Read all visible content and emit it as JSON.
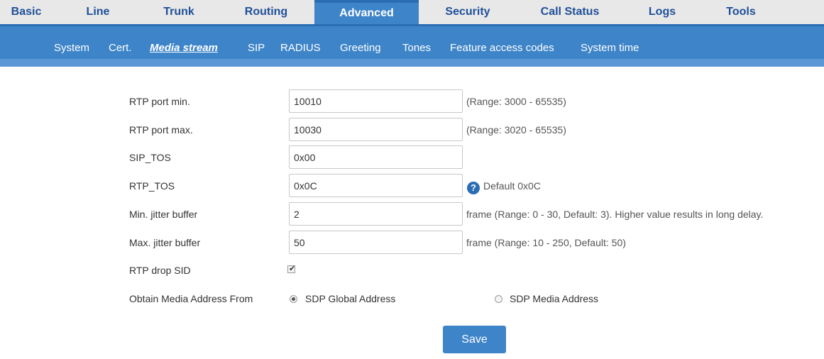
{
  "top_tabs": [
    {
      "label": "Basic"
    },
    {
      "label": "Line"
    },
    {
      "label": "Trunk"
    },
    {
      "label": "Routing"
    },
    {
      "label": "Advanced"
    },
    {
      "label": "Security"
    },
    {
      "label": "Call Status"
    },
    {
      "label": "Logs"
    },
    {
      "label": "Tools"
    }
  ],
  "active_top_tab": "Advanced",
  "sub_tabs": [
    {
      "label": "System"
    },
    {
      "label": "Cert."
    },
    {
      "label": "Media stream"
    },
    {
      "label": "SIP"
    },
    {
      "label": "RADIUS"
    },
    {
      "label": "Greeting"
    },
    {
      "label": "Tones"
    },
    {
      "label": "Feature access codes"
    },
    {
      "label": "System time"
    }
  ],
  "active_sub_tab": "Media stream",
  "form": {
    "rtp_port_min": {
      "label": "RTP port min.",
      "value": "10010",
      "hint": "(Range: 3000 - 65535)"
    },
    "rtp_port_max": {
      "label": "RTP port max.",
      "value": "10030",
      "hint": "(Range: 3020 - 65535)"
    },
    "sip_tos": {
      "label": "SIP_TOS",
      "value": "0x00"
    },
    "rtp_tos": {
      "label": "RTP_TOS",
      "value": "0x0C",
      "hint": "Default 0x0C",
      "help_icon": "question-circle-icon"
    },
    "min_jitter": {
      "label": "Min. jitter buffer",
      "value": "2",
      "hint": "frame (Range: 0 - 30, Default: 3). Higher value results in long delay."
    },
    "max_jitter": {
      "label": "Max. jitter buffer",
      "value": "50",
      "hint": "frame (Range: 10 - 250, Default: 50)"
    },
    "rtp_drop_sid": {
      "label": "RTP drop SID",
      "checked": true
    },
    "media_address": {
      "label": "Obtain Media Address From",
      "options": [
        "SDP Global Address",
        "SDP Media Address"
      ],
      "selected": "SDP Global Address"
    }
  },
  "save_label": "Save",
  "colors": {
    "nav_blue": "#3d84c9",
    "nav_dark": "#2a6db3",
    "tab_text": "#1f4f99"
  }
}
